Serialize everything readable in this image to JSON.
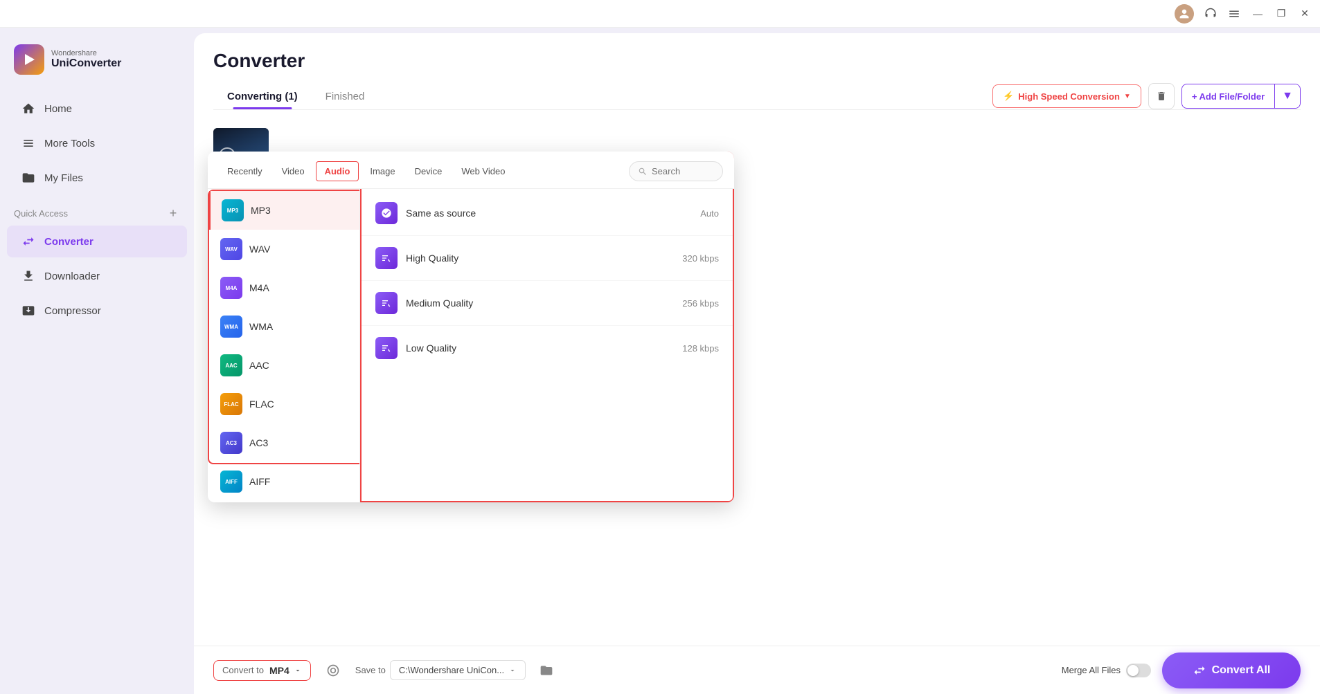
{
  "titlebar": {
    "minimize": "—",
    "maximize": "❐",
    "close": "✕"
  },
  "sidebar": {
    "brand": "Wondershare",
    "name": "UniConverter",
    "nav": [
      {
        "id": "home",
        "label": "Home",
        "active": false
      },
      {
        "id": "more-tools",
        "label": "More Tools",
        "active": false
      },
      {
        "id": "my-files",
        "label": "My Files",
        "active": false
      },
      {
        "id": "converter",
        "label": "Converter",
        "active": true
      },
      {
        "id": "downloader",
        "label": "Downloader",
        "active": false
      },
      {
        "id": "compressor",
        "label": "Compressor",
        "active": false
      }
    ],
    "quick_access_label": "Quick Access",
    "quick_access_plus": "+"
  },
  "main": {
    "page_title": "Converter",
    "tabs": [
      {
        "id": "converting",
        "label": "Converting (1)",
        "active": true
      },
      {
        "id": "finished",
        "label": "Finished",
        "active": false
      }
    ],
    "high_speed_label": "High Speed Conversion",
    "delete_label": "Delete",
    "add_file_label": "+ Add File/Folder"
  },
  "format_dropdown": {
    "tabs": [
      {
        "id": "recently",
        "label": "Recently",
        "active": false
      },
      {
        "id": "video",
        "label": "Video",
        "active": false
      },
      {
        "id": "audio",
        "label": "Audio",
        "active": true
      },
      {
        "id": "image",
        "label": "Image",
        "active": false
      },
      {
        "id": "device",
        "label": "Device",
        "active": false
      },
      {
        "id": "web-video",
        "label": "Web Video",
        "active": false
      }
    ],
    "search_placeholder": "Search",
    "formats": [
      {
        "id": "mp3",
        "label": "MP3",
        "badge_class": "badge-mp3",
        "selected": true
      },
      {
        "id": "wav",
        "label": "WAV",
        "badge_class": "badge-wav",
        "selected": false
      },
      {
        "id": "m4a",
        "label": "M4A",
        "badge_class": "badge-m4a",
        "selected": false
      },
      {
        "id": "wma",
        "label": "WMA",
        "badge_class": "badge-wma",
        "selected": false
      },
      {
        "id": "aac",
        "label": "AAC",
        "badge_class": "badge-aac",
        "selected": false
      },
      {
        "id": "flac",
        "label": "FLAC",
        "badge_class": "badge-flac",
        "selected": false
      },
      {
        "id": "ac3",
        "label": "AC3",
        "badge_class": "badge-ac3",
        "selected": false
      },
      {
        "id": "aiff",
        "label": "AIFF",
        "badge_class": "badge-aiff",
        "selected": false
      }
    ],
    "qualities": [
      {
        "id": "same-as-source",
        "label": "Same as source",
        "bitrate": "Auto"
      },
      {
        "id": "high-quality",
        "label": "High Quality",
        "bitrate": "320 kbps"
      },
      {
        "id": "medium-quality",
        "label": "Medium Quality",
        "bitrate": "256 kbps"
      },
      {
        "id": "low-quality",
        "label": "Low Quality",
        "bitrate": "128 kbps"
      }
    ]
  },
  "bottom_bar": {
    "convert_to_label": "Convert to",
    "convert_to_value": "MP4",
    "save_to_label": "Save to",
    "save_to_path": "C:\\Wondershare UniCon...",
    "merge_label": "Merge All Files",
    "convert_all_label": "Convert All"
  }
}
